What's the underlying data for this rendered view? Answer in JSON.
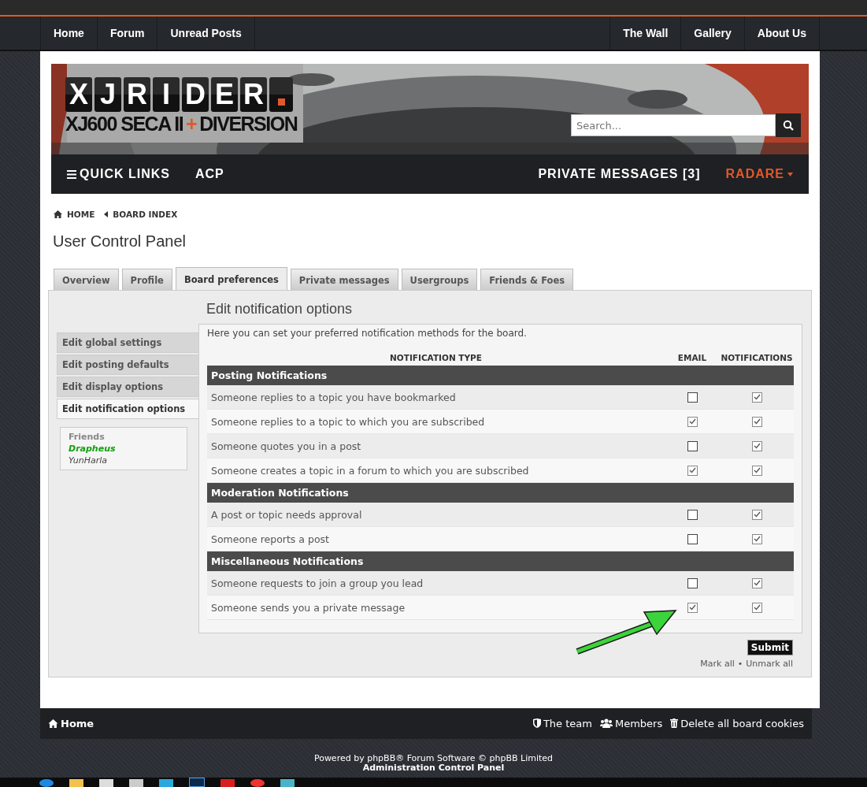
{
  "top_nav": {
    "left": [
      "Home",
      "Forum",
      "Unread Posts"
    ],
    "right": [
      "The Wall",
      "Gallery",
      "About Us"
    ]
  },
  "header": {
    "logo_letters": [
      "X",
      "J",
      "R",
      "I",
      "D",
      "E",
      "R"
    ],
    "logo_sub": "XJ600 SECA II",
    "logo_plus": "+",
    "logo_sub2": "DIVERSION",
    "search": {
      "placeholder": "Search..."
    }
  },
  "sub_nav": {
    "quick_links": "QUICK LINKS",
    "acp": "ACP",
    "private_messages": "PRIVATE MESSAGES [3]",
    "user": "RADARE"
  },
  "breadcrumbs": [
    "HOME",
    "BOARD INDEX"
  ],
  "page_title": "User Control Panel",
  "tabs": [
    {
      "label": "Overview",
      "selected": false
    },
    {
      "label": "Profile",
      "selected": false
    },
    {
      "label": "Board preferences",
      "selected": true
    },
    {
      "label": "Private messages",
      "selected": false
    },
    {
      "label": "Usergroups",
      "selected": false
    },
    {
      "label": "Friends & Foes",
      "selected": false
    }
  ],
  "side_menu": [
    {
      "label": "Edit global settings",
      "selected": false
    },
    {
      "label": "Edit posting defaults",
      "selected": false
    },
    {
      "label": "Edit display options",
      "selected": false
    },
    {
      "label": "Edit notification options",
      "selected": true
    }
  ],
  "friends": {
    "title": "Friends",
    "list": [
      {
        "name": "Drapheus",
        "online": true
      },
      {
        "name": "YunHarla",
        "online": false
      }
    ]
  },
  "content": {
    "heading": "Edit notification options",
    "intro": "Here you can set your preferred notification methods for the board.",
    "columns": [
      "NOTIFICATION TYPE",
      "EMAIL",
      "NOTIFICATIONS"
    ],
    "groups": [
      {
        "title": "Posting Notifications",
        "rows": [
          {
            "label": "Someone replies to a topic you have bookmarked",
            "email": false,
            "notifications": true
          },
          {
            "label": "Someone replies to a topic to which you are subscribed",
            "email": true,
            "notifications": true
          },
          {
            "label": "Someone quotes you in a post",
            "email": false,
            "notifications": true
          },
          {
            "label": "Someone creates a topic in a forum to which you are subscribed",
            "email": true,
            "notifications": true
          }
        ]
      },
      {
        "title": "Moderation Notifications",
        "rows": [
          {
            "label": "A post or topic needs approval",
            "email": false,
            "notifications": true
          },
          {
            "label": "Someone reports a post",
            "email": false,
            "notifications": true
          }
        ]
      },
      {
        "title": "Miscellaneous Notifications",
        "rows": [
          {
            "label": "Someone requests to join a group you lead",
            "email": false,
            "notifications": true
          },
          {
            "label": "Someone sends you a private message",
            "email": true,
            "notifications": true
          }
        ]
      }
    ],
    "submit": "Submit",
    "mark_all": "Mark all",
    "separator": "•",
    "unmark_all": "Unmark all"
  },
  "footer": {
    "home": "Home",
    "links": [
      {
        "kind": "team",
        "label": "The team"
      },
      {
        "kind": "members",
        "label": "Members"
      },
      {
        "kind": "cookies",
        "label": "Delete all board cookies"
      }
    ]
  },
  "powered": "Powered by phpBB® Forum Software © phpBB Limited",
  "acp_link": "Administration Control Panel"
}
